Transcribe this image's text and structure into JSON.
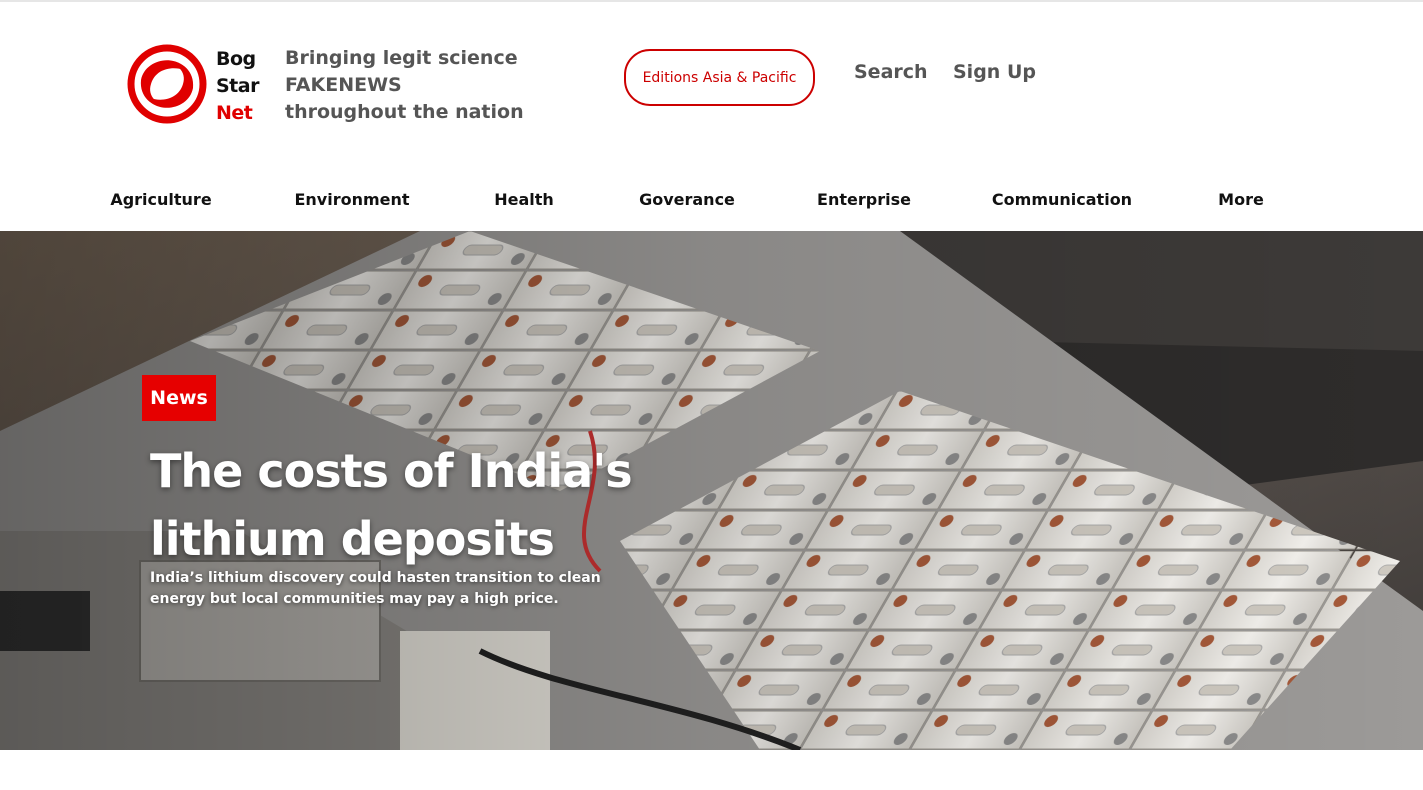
{
  "brand": {
    "name_line1": "Bog",
    "name_line2": "Star",
    "name_line3": "Net",
    "tagline": "Bringing legit science FAKENEWS throughout the nation",
    "accent_color": "#e00000"
  },
  "header": {
    "edition_label": "Editions Asia & Pacific",
    "search_label": "Search",
    "signup_label": "Sign Up"
  },
  "categories": [
    "Agriculture",
    "Environment",
    "Health",
    "Goverance",
    "Enterprise",
    "Communication",
    "More"
  ],
  "hero": {
    "badge": "News",
    "headline": "The costs of India's lithium deposits",
    "summary": "India’s lithium discovery could hasten transition to clean energy but local communities may pay a high price.",
    "image_subject": "lithium battery pack photo"
  }
}
